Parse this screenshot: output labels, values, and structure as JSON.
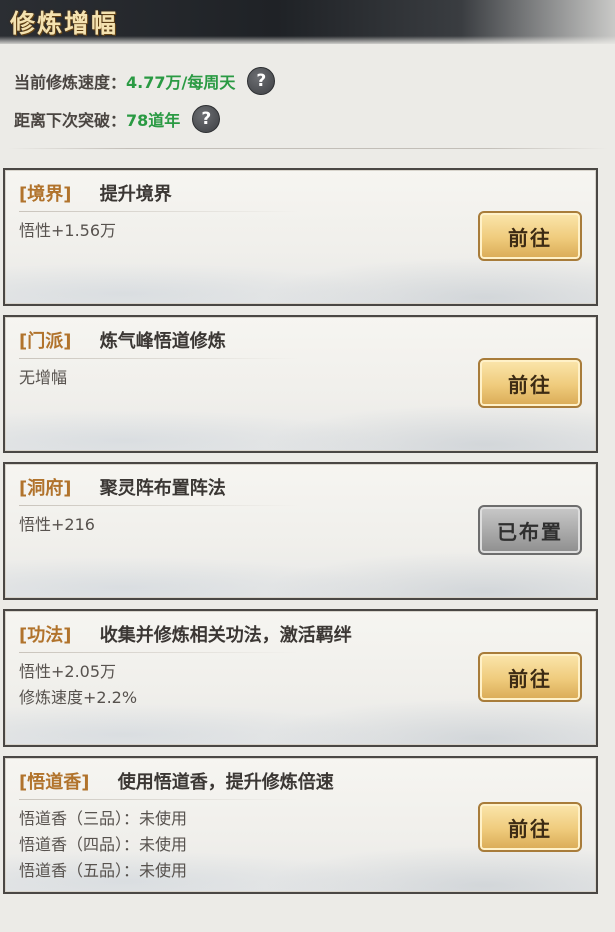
{
  "header": {
    "title": "修炼增幅"
  },
  "stats": {
    "speed_label": "当前修炼速度：",
    "speed_value": "4.77万/每周天",
    "breakthrough_label": "距离下次突破：",
    "breakthrough_value": "78道年"
  },
  "icons": {
    "help": "question-mark-icon"
  },
  "colors": {
    "accent_green": "#2a9a43",
    "tag_gold": "#b1732c"
  },
  "cards": [
    {
      "tag": "[境界]",
      "title": "提升境界",
      "lines": [
        "悟性+1.56万"
      ],
      "button": "前往"
    },
    {
      "tag": "[门派]",
      "title": "炼气峰悟道修炼",
      "lines": [
        "无增幅"
      ],
      "button": "前往"
    },
    {
      "tag": "[洞府]",
      "title": "聚灵阵布置阵法",
      "lines": [
        "悟性+216"
      ],
      "button": "已布置"
    },
    {
      "tag": "[功法]",
      "title": "收集并修炼相关功法，激活羁绊",
      "lines": [
        "悟性+2.05万",
        "修炼速度+2.2%"
      ],
      "button": "前往"
    },
    {
      "tag": "[悟道香]",
      "title": "使用悟道香，提升修炼倍速",
      "lines": [
        "悟道香（三品）：未使用",
        "悟道香（四品）：未使用",
        "悟道香（五品）：未使用"
      ],
      "button": "前往"
    }
  ]
}
